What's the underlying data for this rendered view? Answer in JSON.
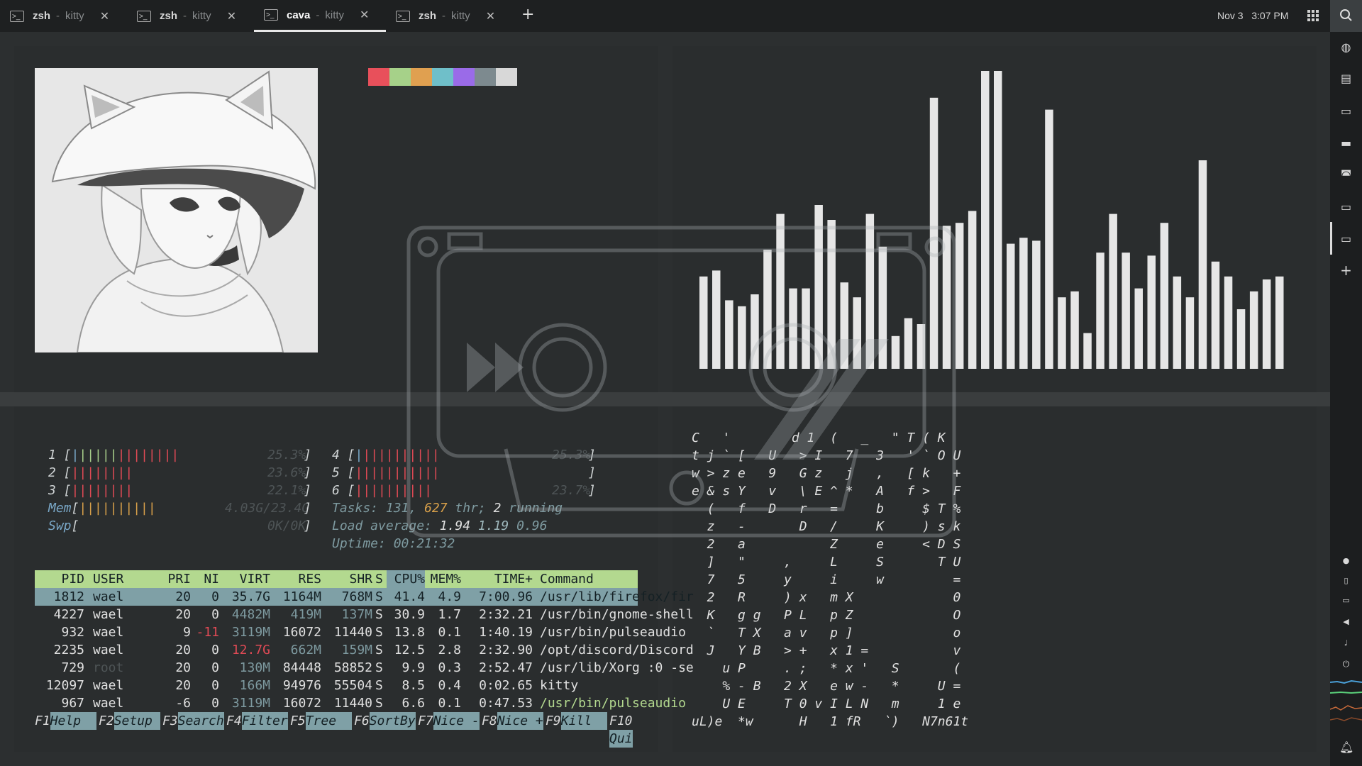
{
  "tabs": [
    {
      "name": "zsh",
      "app": "kitty",
      "active": false
    },
    {
      "name": "zsh",
      "app": "kitty",
      "active": false
    },
    {
      "name": "cava",
      "app": "kitty",
      "active": true
    },
    {
      "name": "zsh",
      "app": "kitty",
      "active": false
    }
  ],
  "tab_separator": "-",
  "tab_icon_glyph": ">_",
  "new_tab_label": "+",
  "clock": {
    "date": "Nov 3",
    "time": "3:07 PM"
  },
  "palette": [
    "#e8505b",
    "#a6d189",
    "#e0a050",
    "#6fbfc9",
    "#9a6be8",
    "#7d8a8f",
    "#d8d8d8"
  ],
  "dock_icons": [
    "search-icon",
    "globe-icon",
    "chat-icon",
    "terminal-icon",
    "files-icon",
    "gamepad-icon",
    "terminal-icon",
    "terminal-icon",
    "plus-icon"
  ],
  "tray_icons": [
    "circle-icon",
    "clipboard-icon",
    "display-icon",
    "volume-icon",
    "mic-icon",
    "power-icon",
    "bell-icon"
  ],
  "cava_levels": [
    0.31,
    0.33,
    0.23,
    0.21,
    0.25,
    0.4,
    0.52,
    0.27,
    0.27,
    0.55,
    0.5,
    0.29,
    0.24,
    0.52,
    0.41,
    0.11,
    0.17,
    0.15,
    0.91,
    0.48,
    0.49,
    0.53,
    1.0,
    1.0,
    0.42,
    0.44,
    0.43,
    0.87,
    0.24,
    0.26,
    0.12,
    0.39,
    0.52,
    0.39,
    0.27,
    0.38,
    0.49,
    0.31,
    0.24,
    0.7,
    0.36,
    0.31,
    0.2,
    0.26,
    0.3,
    0.31
  ],
  "htop": {
    "cpus_left": [
      {
        "n": "1",
        "bar": "||||||||",
        "pct": "25.3%"
      },
      {
        "n": "2",
        "bar": "||||||||",
        "pct": "23.6%"
      },
      {
        "n": "3",
        "bar": "||||||||",
        "pct": "22.1%"
      }
    ],
    "cpus_right": [
      {
        "n": "4",
        "bar": "||||||||||",
        "pct": "25.3%"
      },
      {
        "n": "5",
        "bar": "|||||||||||",
        "pct": ""
      },
      {
        "n": "6",
        "bar": "||||||||||",
        "pct": "23.7%"
      }
    ],
    "mem": {
      "label": "Mem",
      "bar": "||||||||||",
      "val": "4.03G/23.4G"
    },
    "swp": {
      "label": "Swp",
      "val": "0K/0K"
    },
    "tasks": {
      "prefix": "Tasks: ",
      "tasks": "131",
      "sep1": ", ",
      "thr": "627",
      "thr_label": " thr; ",
      "running": "2",
      "running_label": " running"
    },
    "load": {
      "prefix": "Load average: ",
      "l1": "1.94",
      "l5": "1.19",
      "l15": "0.96"
    },
    "uptime": {
      "prefix": "Uptime: ",
      "val": "00:21:32"
    },
    "columns": [
      "PID",
      "USER",
      "PRI",
      "NI",
      "VIRT",
      "RES",
      "SHR",
      "S",
      "CPU%",
      "MEM%",
      "TIME+",
      "Command"
    ],
    "rows": [
      {
        "pid": "1812",
        "user": "wael",
        "pri": "20",
        "ni": "0",
        "virt": "35.7G",
        "res": "1164M",
        "shr": "768M",
        "s": "S",
        "cpu": "41.4",
        "mem": "4.9",
        "time": "7:00.96",
        "cmd": "/usr/lib/firefox/fir"
      },
      {
        "pid": "4227",
        "user": "wael",
        "pri": "20",
        "ni": "0",
        "virt": "4482M",
        "res": "419M",
        "shr": "137M",
        "s": "S",
        "cpu": "30.9",
        "mem": "1.7",
        "time": "2:32.21",
        "cmd": "/usr/bin/gnome-shell"
      },
      {
        "pid": "932",
        "user": "wael",
        "pri": "9",
        "ni": "-11",
        "virt": "3119M",
        "res": "16072",
        "shr": "11440",
        "s": "S",
        "cpu": "13.8",
        "mem": "0.1",
        "time": "1:40.19",
        "cmd": "/usr/bin/pulseaudio"
      },
      {
        "pid": "2235",
        "user": "wael",
        "pri": "20",
        "ni": "0",
        "virt": "12.7G",
        "res": "662M",
        "shr": "159M",
        "s": "S",
        "cpu": "12.5",
        "mem": "2.8",
        "time": "2:32.90",
        "cmd": "/opt/discord/Discord"
      },
      {
        "pid": "729",
        "user": "root",
        "pri": "20",
        "ni": "0",
        "virt": "130M",
        "res": "84448",
        "shr": "58852",
        "s": "S",
        "cpu": "9.9",
        "mem": "0.3",
        "time": "2:52.47",
        "cmd": "/usr/lib/Xorg :0 -se"
      },
      {
        "pid": "12097",
        "user": "wael",
        "pri": "20",
        "ni": "0",
        "virt": "166M",
        "res": "94976",
        "shr": "55504",
        "s": "S",
        "cpu": "8.5",
        "mem": "0.4",
        "time": "0:02.65",
        "cmd": "kitty"
      },
      {
        "pid": "967",
        "user": "wael",
        "pri": "-6",
        "ni": "0",
        "virt": "3119M",
        "res": "16072",
        "shr": "11440",
        "s": "S",
        "cpu": "6.6",
        "mem": "0.1",
        "time": "0:47.53",
        "cmd": "/usr/bin/pulseaudio"
      }
    ],
    "fkeys": [
      {
        "k": "F1",
        "l": "Help  "
      },
      {
        "k": "F2",
        "l": "Setup "
      },
      {
        "k": "F3",
        "l": "Search"
      },
      {
        "k": "F4",
        "l": "Filter"
      },
      {
        "k": "F5",
        "l": "Tree  "
      },
      {
        "k": "F6",
        "l": "SortBy"
      },
      {
        "k": "F7",
        "l": "Nice -"
      },
      {
        "k": "F8",
        "l": "Nice +"
      },
      {
        "k": "F9",
        "l": "Kill  "
      },
      {
        "k": "F10",
        "l": "Qui"
      }
    ]
  },
  "matrix_lines": [
    "C   '        d 1  (   _   \" T ( K",
    "t j ` [   U   > I   7   3   ' ` O U",
    "w > z e   9   G z   j   ,   [ k   +",
    "e & s Y   v   \\ E ^ *   A   f >   F",
    "  (   f   D   r   =     b     $ T %",
    "  z   -       D   /     K     ) s k",
    "  2   a           Z     e     < D S",
    "  ]   \"     ,     L     S       T U",
    "  7   5     y     i     w         =",
    "  2   R     ) x   m X             0",
    "  K   g g   P L   p Z             O",
    "  `   T X   a v   p ]             o",
    "  J   Y B   > +   x 1 =           v",
    "    u P     . ;   * x '   S       (",
    "    % - B   2 X   e w -   *     U =",
    "    U E     T 0 v I L N   m     1 e",
    "uL)e  *w      H   1 fR   `)   N7n61t"
  ]
}
